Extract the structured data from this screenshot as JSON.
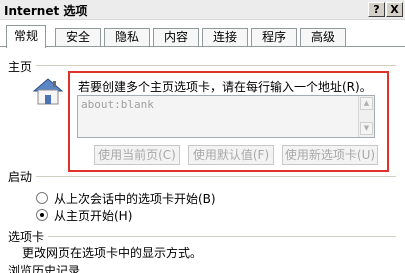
{
  "window": {
    "title": "Internet 选项",
    "help_button": "?",
    "close_button": "X"
  },
  "tabs": [
    "常规",
    "安全",
    "隐私",
    "内容",
    "连接",
    "程序",
    "高级"
  ],
  "home_page": {
    "section_label": "主页",
    "instruction": "若要创建多个主页选项卡，请在每行输入一个地址(R)。",
    "address_value": "about:blank",
    "buttons": {
      "use_current": "使用当前页(C)",
      "use_default": "使用默认值(F)",
      "use_new_tab": "使用新选项卡(U)"
    }
  },
  "startup": {
    "section_label": "启动",
    "options": [
      {
        "label": "从上次会话中的选项卡开始(B)",
        "selected": false
      },
      {
        "label": "从主页开始(H)",
        "selected": true
      }
    ]
  },
  "tabs_section": {
    "section_label": "选项卡",
    "description": "更改网页在选项卡中的显示方式。"
  },
  "history_section": {
    "section_label": "浏览历史记录"
  },
  "colors": {
    "highlight_border": "#e0322a",
    "disabled_text": "#a8a8a8"
  }
}
